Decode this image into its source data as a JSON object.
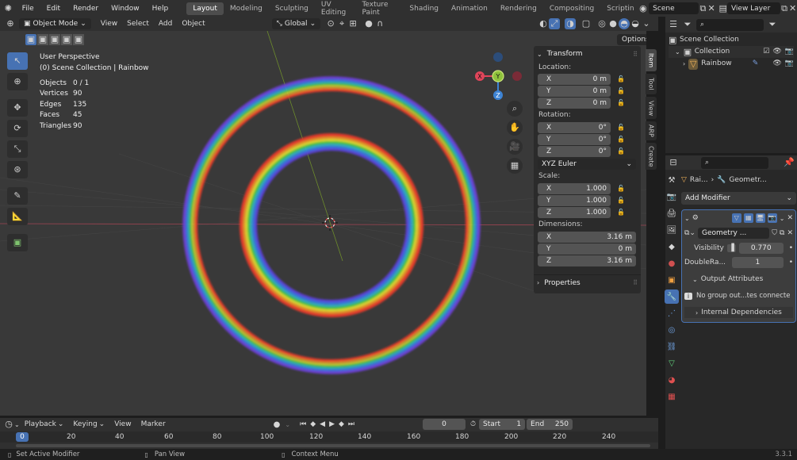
{
  "topbar": {
    "menus": [
      "File",
      "Edit",
      "Render",
      "Window",
      "Help"
    ],
    "workspaces": [
      "Layout",
      "Modeling",
      "Sculpting",
      "UV Editing",
      "Texture Paint",
      "Shading",
      "Animation",
      "Rendering",
      "Compositing",
      "Scriptin"
    ],
    "active_workspace": "Layout",
    "scene": "Scene",
    "view_layer": "View Layer"
  },
  "viewport_header": {
    "mode": "Object Mode",
    "menus": [
      "View",
      "Select",
      "Add",
      "Object"
    ],
    "orientation": "Global",
    "options": "Options"
  },
  "overlay": {
    "perspective": "User Perspective",
    "collection": "(0) Scene Collection | Rainbow",
    "stats": [
      {
        "label": "Objects",
        "value": "0 / 1"
      },
      {
        "label": "Vertices",
        "value": "90"
      },
      {
        "label": "Edges",
        "value": "135"
      },
      {
        "label": "Faces",
        "value": "45"
      },
      {
        "label": "Triangles",
        "value": "90"
      }
    ]
  },
  "gizmo": {
    "x": "X",
    "y": "Y",
    "z": "Z"
  },
  "npanel": {
    "title": "Transform",
    "location_label": "Location:",
    "location": [
      {
        "axis": "X",
        "value": "0 m"
      },
      {
        "axis": "Y",
        "value": "0 m"
      },
      {
        "axis": "Z",
        "value": "0 m"
      }
    ],
    "rotation_label": "Rotation:",
    "rotation": [
      {
        "axis": "X",
        "value": "0°"
      },
      {
        "axis": "Y",
        "value": "0°"
      },
      {
        "axis": "Z",
        "value": "0°"
      }
    ],
    "rotation_mode": "XYZ Euler",
    "scale_label": "Scale:",
    "scale": [
      {
        "axis": "X",
        "value": "1.000"
      },
      {
        "axis": "Y",
        "value": "1.000"
      },
      {
        "axis": "Z",
        "value": "1.000"
      }
    ],
    "dimensions_label": "Dimensions:",
    "dimensions": [
      {
        "axis": "X",
        "value": "3.16 m"
      },
      {
        "axis": "Y",
        "value": "0 m"
      },
      {
        "axis": "Z",
        "value": "3.16 m"
      }
    ],
    "properties": "Properties",
    "tabs": [
      "Item",
      "Tool",
      "View",
      "ARP",
      "Create"
    ]
  },
  "outliner": {
    "root": "Scene Collection",
    "collection": "Collection",
    "object": "Rainbow"
  },
  "properties": {
    "breadcrumb_object": "Rai...",
    "breadcrumb_modifier": "Geometr...",
    "add_modifier": "Add Modifier",
    "modifier_name": "Geometry ...",
    "visibility_label": "Visibility",
    "visibility_value": "0.770",
    "doubleray_label": "DoubleRa...",
    "doubleray_value": "1",
    "output_attributes": "Output Attributes",
    "warning": "No group out...tes connecte",
    "internal_dependencies": "Internal Dependencies"
  },
  "timeline": {
    "menus": [
      "Playback",
      "Keying",
      "View",
      "Marker"
    ],
    "current_frame": "0",
    "start_label": "Start",
    "start": "1",
    "end_label": "End",
    "end": "250",
    "ruler": [
      "0",
      "20",
      "40",
      "60",
      "80",
      "100",
      "120",
      "140",
      "160",
      "180",
      "200",
      "220",
      "240"
    ]
  },
  "statusbar": {
    "left": "Set Active Modifier",
    "middle": "Pan View",
    "right": "Context Menu",
    "version": "3.3.1"
  },
  "colors": {
    "accent": "#4772b3",
    "x_axis": "#e0455a",
    "y_axis": "#8fc23c",
    "z_axis": "#3d83d4"
  }
}
